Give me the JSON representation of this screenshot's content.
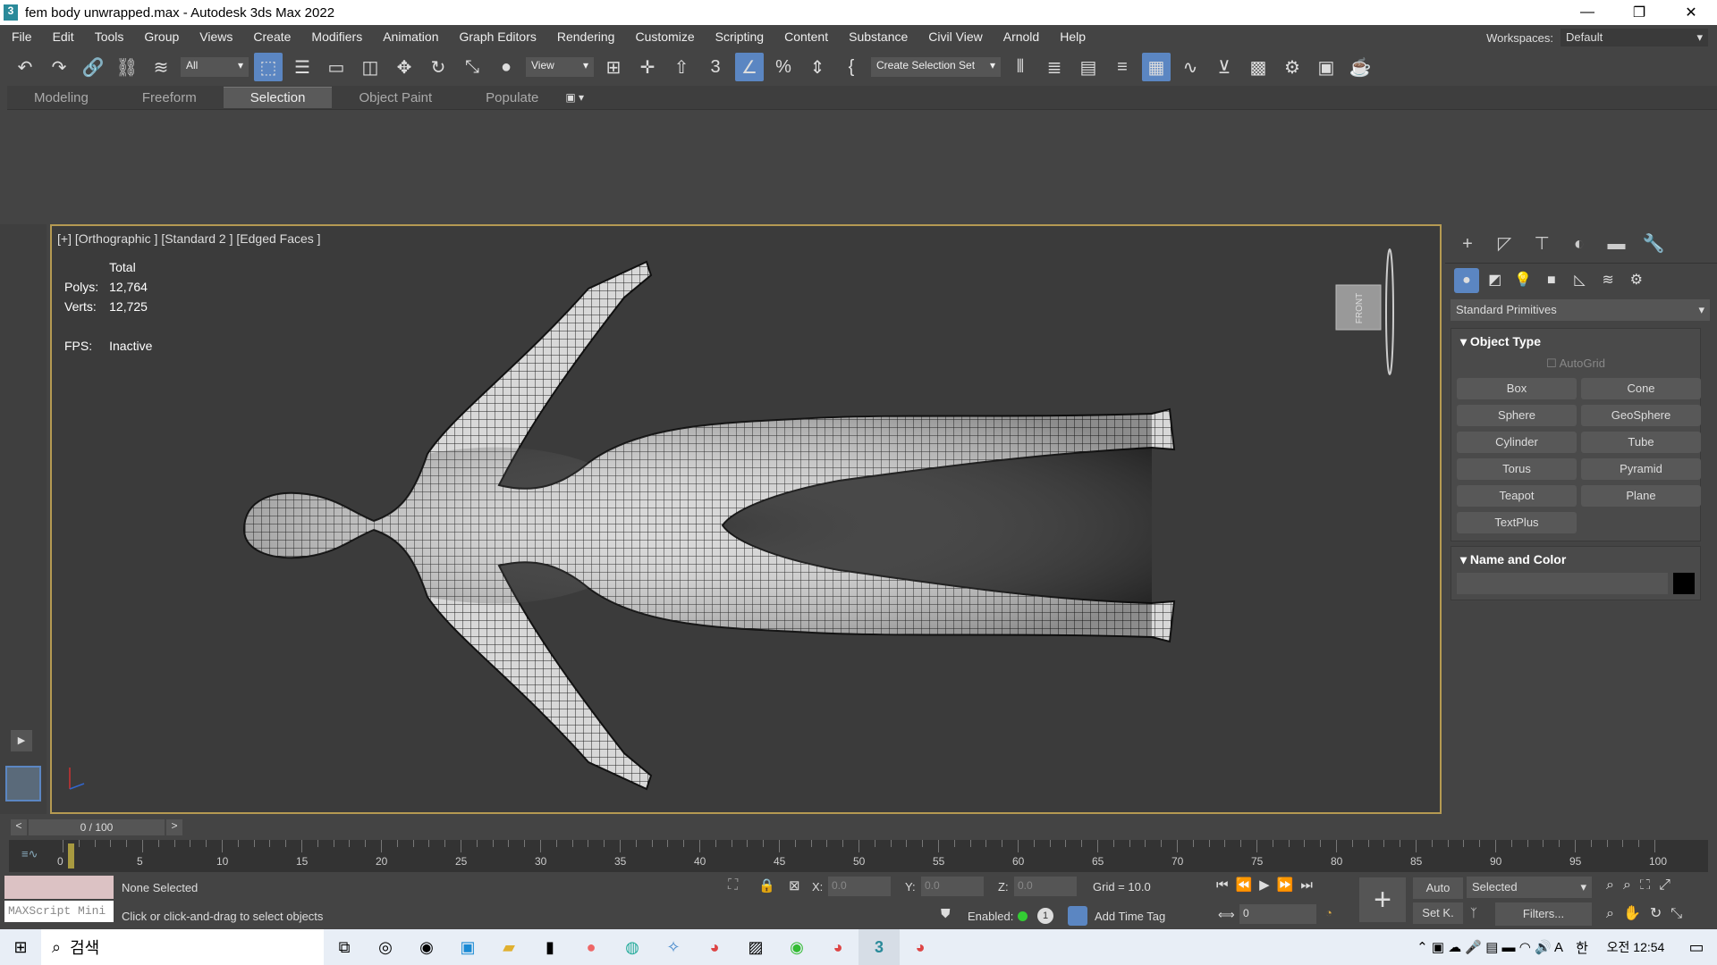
{
  "title": "fem body unwrapped.max - Autodesk 3ds Max 2022",
  "app_icon_text": "3",
  "window_controls": [
    "—",
    "❐",
    "✕"
  ],
  "menu": [
    "File",
    "Edit",
    "Tools",
    "Group",
    "Views",
    "Create",
    "Modifiers",
    "Animation",
    "Graph Editors",
    "Rendering",
    "Customize",
    "Scripting",
    "Content",
    "Substance",
    "Civil View",
    "Arnold",
    "Help"
  ],
  "workspace": {
    "label": "Workspaces:",
    "value": "Default"
  },
  "toolbar": {
    "filter": "All",
    "view": "View",
    "selection_set": "Create Selection Set"
  },
  "ribbon": {
    "tabs": [
      "Modeling",
      "Freeform",
      "Selection",
      "Object Paint",
      "Populate"
    ],
    "active": "Selection"
  },
  "viewport": {
    "label": "[+] [Orthographic ] [Standard 2 ] [Edged Faces ]",
    "stats_header": "Total",
    "polys_label": "Polys:",
    "polys": "12,764",
    "verts_label": "Verts:",
    "verts": "12,725",
    "fps_label": "FPS:",
    "fps": "Inactive",
    "viewcube": "FRONT"
  },
  "command_panel": {
    "dropdown": "Standard Primitives",
    "object_type": "Object Type",
    "autogrid": "AutoGrid",
    "buttons": [
      "Box",
      "Cone",
      "Sphere",
      "GeoSphere",
      "Cylinder",
      "Tube",
      "Torus",
      "Pyramid",
      "Teapot",
      "Plane",
      "TextPlus"
    ],
    "name_and_color": "Name and Color",
    "color": "#000000"
  },
  "timeline": {
    "frame": "0 / 100",
    "progress": 0,
    "ticks": [
      "0",
      "5",
      "10",
      "15",
      "20",
      "25",
      "30",
      "35",
      "40",
      "45",
      "50",
      "55",
      "60",
      "65",
      "70",
      "75",
      "80",
      "85",
      "90",
      "95",
      "100"
    ]
  },
  "status": {
    "maxscript": "MAXScript Mini",
    "selection": "None Selected",
    "prompt": "Click or click-and-drag to select objects",
    "x_label": "X:",
    "x": "0.0",
    "y_label": "Y:",
    "y": "0.0",
    "z_label": "Z:",
    "z": "0.0",
    "grid": "Grid = 10.0",
    "enabled": "Enabled:",
    "add_time_tag": "Add Time Tag",
    "auto": "Auto",
    "set_key": "Set K.",
    "key_filter": "Selected",
    "filters": "Filters...",
    "frame_field": "0"
  },
  "taskbar": {
    "search": "검색",
    "ime": "한",
    "time": "오전 12:54"
  }
}
